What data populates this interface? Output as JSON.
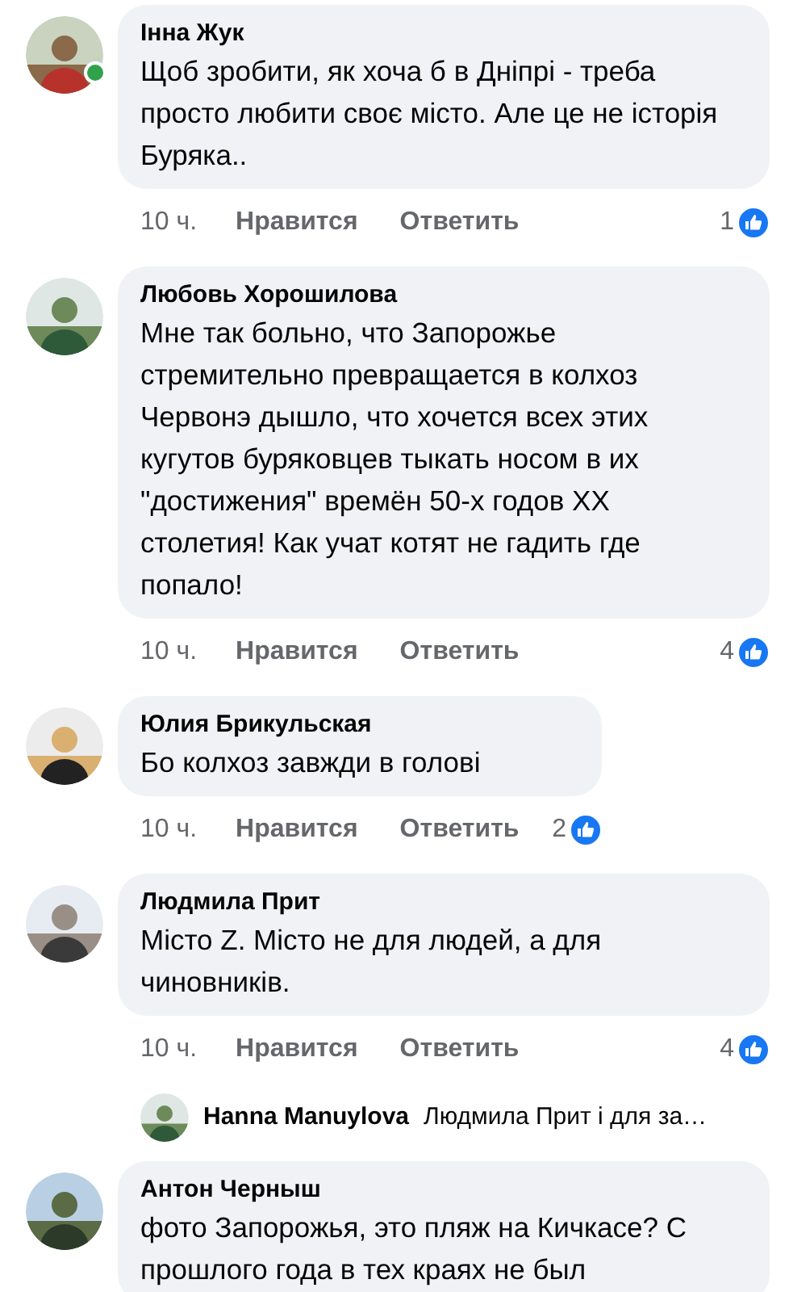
{
  "comments": [
    {
      "author": "Інна Жук",
      "text": "Щоб зробити, як хоча б в Дніпрі - треба просто любити своє місто. Але це не історія Буряка..",
      "online": true,
      "time": "10 ч.",
      "like": "Нравится",
      "reply": "Ответить",
      "likes": "1"
    },
    {
      "author": "Любовь Хорошилова",
      "text": "Мне так больно, что Запорожье стремительно превращается в колхоз Червонэ дышло, что хочется всех этих кугутов буряковцев тыкать носом в их \"достижения\" времён 50-х годов XX столетия! Как учат котят не гадить где попало!",
      "online": false,
      "time": "10 ч.",
      "like": "Нравится",
      "reply": "Ответить",
      "likes": "4"
    },
    {
      "author": "Юлия Брикульская",
      "text": "Бо колхоз завжди в голові",
      "online": false,
      "time": "10 ч.",
      "like": "Нравится",
      "reply": "Ответить",
      "likes": "2"
    },
    {
      "author": "Людмила Прит",
      "text": "Місто Z. Місто не для людей, а для чиновників.",
      "online": false,
      "time": "10 ч.",
      "like": "Нравится",
      "reply": "Ответить",
      "likes": "4",
      "reply_preview": {
        "author": "Hanna Manuylova",
        "text": "Людмила Прит і для за…"
      }
    },
    {
      "author": "Антон Черныш",
      "text": "фото Запорожья, это пляж на Кичкасе? С прошлого года в тех краях не был",
      "online": false
    }
  ]
}
